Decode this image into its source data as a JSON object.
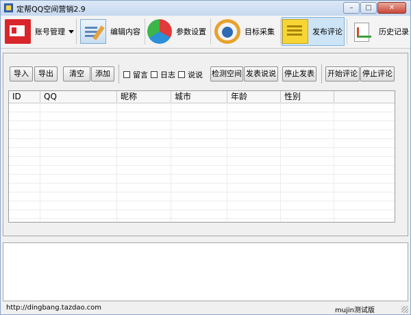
{
  "window": {
    "title": "定帮QQ空间营销2.9"
  },
  "titlebar_buttons": [
    "–",
    "□",
    "✕"
  ],
  "toolbar": {
    "items": [
      {
        "label": "账号管理",
        "icon": "account-card-icon",
        "dropdown": true
      },
      {
        "label": "编辑内容",
        "icon": "edit-content-icon"
      },
      {
        "label": "参数设置",
        "icon": "pie-settings-icon"
      },
      {
        "label": "目标采集",
        "icon": "collect-icon"
      },
      {
        "label": "发布评论",
        "icon": "post-comment-icon",
        "active": true
      },
      {
        "label": "历史记录",
        "icon": "history-icon"
      }
    ]
  },
  "controls": {
    "import": "导入",
    "export": "导出",
    "clear": "清空",
    "add": "添加",
    "checks": [
      {
        "label": "留言",
        "checked": false
      },
      {
        "label": "日志",
        "checked": false
      },
      {
        "label": "说说",
        "checked": false
      }
    ],
    "detect_space": "检测空间",
    "post_shuoshuo": "发表说说",
    "stop_post": "停止发表",
    "start_comment": "开始评论",
    "stop_comment": "停止评论"
  },
  "table": {
    "columns": [
      "ID",
      "QQ",
      "昵称",
      "城市",
      "年龄",
      "性别"
    ],
    "rows": []
  },
  "output": {
    "text": ""
  },
  "status": {
    "url": "http://dingbang.tazdao.com",
    "mode": "mujin测试版"
  }
}
